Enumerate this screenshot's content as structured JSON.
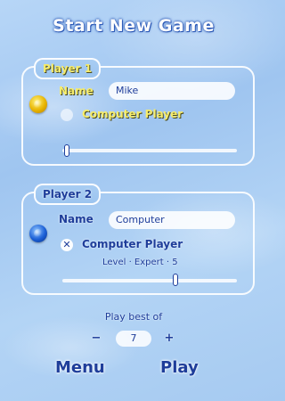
{
  "screen": {
    "title": "Start New Game"
  },
  "player1": {
    "label": "Player 1",
    "orb_color": "#e8b400",
    "name_label": "Name",
    "name_value": "Mike",
    "computer_label": "Computer Player",
    "computer_checked": false
  },
  "player2": {
    "label": "Player 2",
    "orb_color": "#1b5fd6",
    "name_label": "Name",
    "name_value": "Computer",
    "computer_label": "Computer Player",
    "computer_checked": true,
    "check_mark": "✕",
    "level_text": "Level · Expert · 5"
  },
  "match": {
    "label": "Play best of",
    "minus": "−",
    "plus": "+",
    "value": "7"
  },
  "actions": {
    "menu_label": "Menu",
    "play_label": "Play"
  },
  "colors": {
    "accent_blue": "#1e3d9a",
    "player1_yellow": "#f6ec6b",
    "background": "#a6caf1"
  }
}
